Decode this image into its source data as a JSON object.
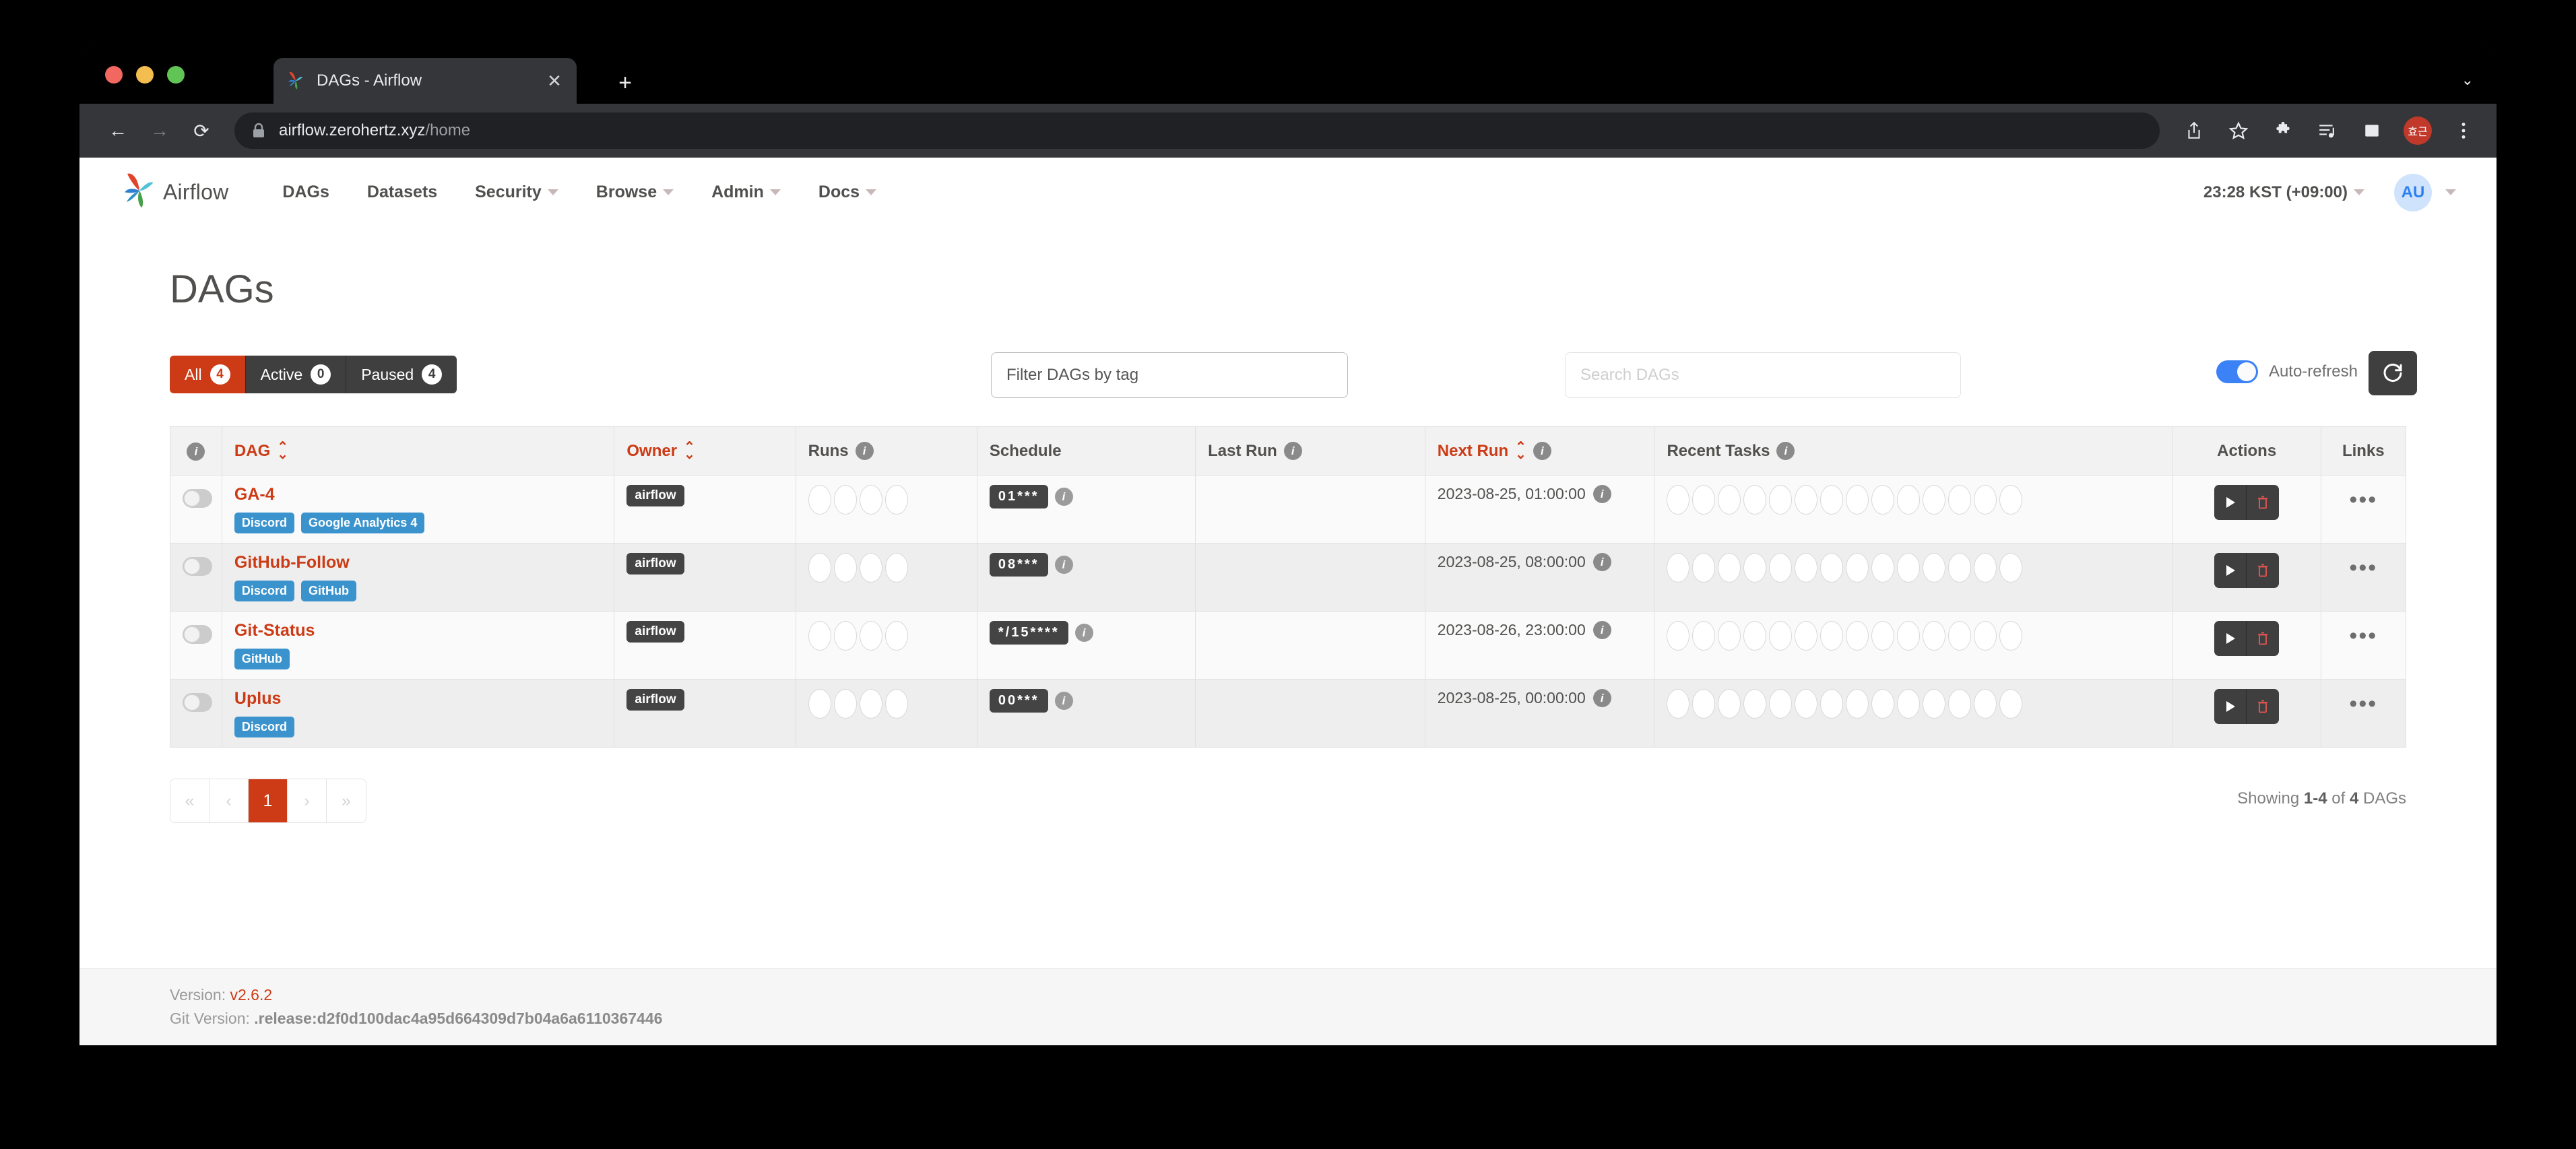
{
  "browser": {
    "tab_title": "DAGs - Airflow",
    "tab_close_icon": "close-icon",
    "new_tab_icon": "plus-icon",
    "back_icon": "back-arrow-icon",
    "forward_icon": "forward-arrow-icon",
    "reload_icon": "reload-icon",
    "lock_icon": "lock-icon",
    "url_domain": "airflow.zerohertz.xyz",
    "url_path": "/home",
    "toolbar_icons": [
      "share-icon",
      "star-icon",
      "extensions-puzzle-icon",
      "media-list-icon",
      "side-panel-icon",
      "profile-avatar-icon",
      "kebab-menu-icon"
    ],
    "profile_initials": "효근"
  },
  "nav": {
    "brand": "Airflow",
    "links": [
      {
        "label": "DAGs",
        "caret": false
      },
      {
        "label": "Datasets",
        "caret": false
      },
      {
        "label": "Security",
        "caret": true
      },
      {
        "label": "Browse",
        "caret": true
      },
      {
        "label": "Admin",
        "caret": true
      },
      {
        "label": "Docs",
        "caret": true
      }
    ],
    "clock": "23:28 KST (+09:00)",
    "avatar_initials": "AU"
  },
  "page": {
    "title": "DAGs"
  },
  "controls": {
    "filters": [
      {
        "label": "All",
        "count": "4",
        "active": true
      },
      {
        "label": "Active",
        "count": "0",
        "active": false
      },
      {
        "label": "Paused",
        "count": "4",
        "active": false
      }
    ],
    "tag_filter_value": "Filter DAGs by tag",
    "search_placeholder": "Search DAGs",
    "autorefresh_label": "Auto-refresh",
    "autorefresh_on": true,
    "refresh_icon": "refresh-icon"
  },
  "table": {
    "headers": {
      "info": "info-icon",
      "dag": "DAG",
      "owner": "Owner",
      "runs": "Runs",
      "schedule": "Schedule",
      "last_run": "Last Run",
      "next_run": "Next Run",
      "recent_tasks": "Recent Tasks",
      "actions": "Actions",
      "links": "Links"
    },
    "runs_circle_count": 4,
    "tasks_circle_count": 14,
    "rows": [
      {
        "name": "GA-4",
        "tags": [
          "Discord",
          "Google Analytics 4"
        ],
        "owner": "airflow",
        "schedule": "0 1 * * *",
        "last_run": "",
        "next_run": "2023-08-25, 01:00:00",
        "paused": true
      },
      {
        "name": "GitHub-Follow",
        "tags": [
          "Discord",
          "GitHub"
        ],
        "owner": "airflow",
        "schedule": "0 8 * * *",
        "last_run": "",
        "next_run": "2023-08-25, 08:00:00",
        "paused": true
      },
      {
        "name": "Git-Status",
        "tags": [
          "GitHub"
        ],
        "owner": "airflow",
        "schedule": "*/15 * * * *",
        "last_run": "",
        "next_run": "2023-08-26, 23:00:00",
        "paused": true
      },
      {
        "name": "Uplus",
        "tags": [
          "Discord"
        ],
        "owner": "airflow",
        "schedule": "0 0 * * *",
        "last_run": "",
        "next_run": "2023-08-25, 00:00:00",
        "paused": true
      }
    ]
  },
  "pagination": {
    "first": "«",
    "prev": "‹",
    "current": "1",
    "next": "›",
    "last": "»",
    "showing_prefix": "Showing ",
    "showing_range": "1-4",
    "showing_middle": " of ",
    "showing_total": "4",
    "showing_suffix": " DAGs"
  },
  "footer": {
    "version_label": "Version: ",
    "version_value": "v2.6.2",
    "git_label": "Git Version: ",
    "git_value": ".release:d2f0d100dac4a95d664309d7b04a6a6110367446"
  },
  "colors": {
    "accent": "#cc3b15",
    "tag_blue": "#3b93cd",
    "dark": "#3f3f3f",
    "toggle_blue": "#3b82f6"
  }
}
